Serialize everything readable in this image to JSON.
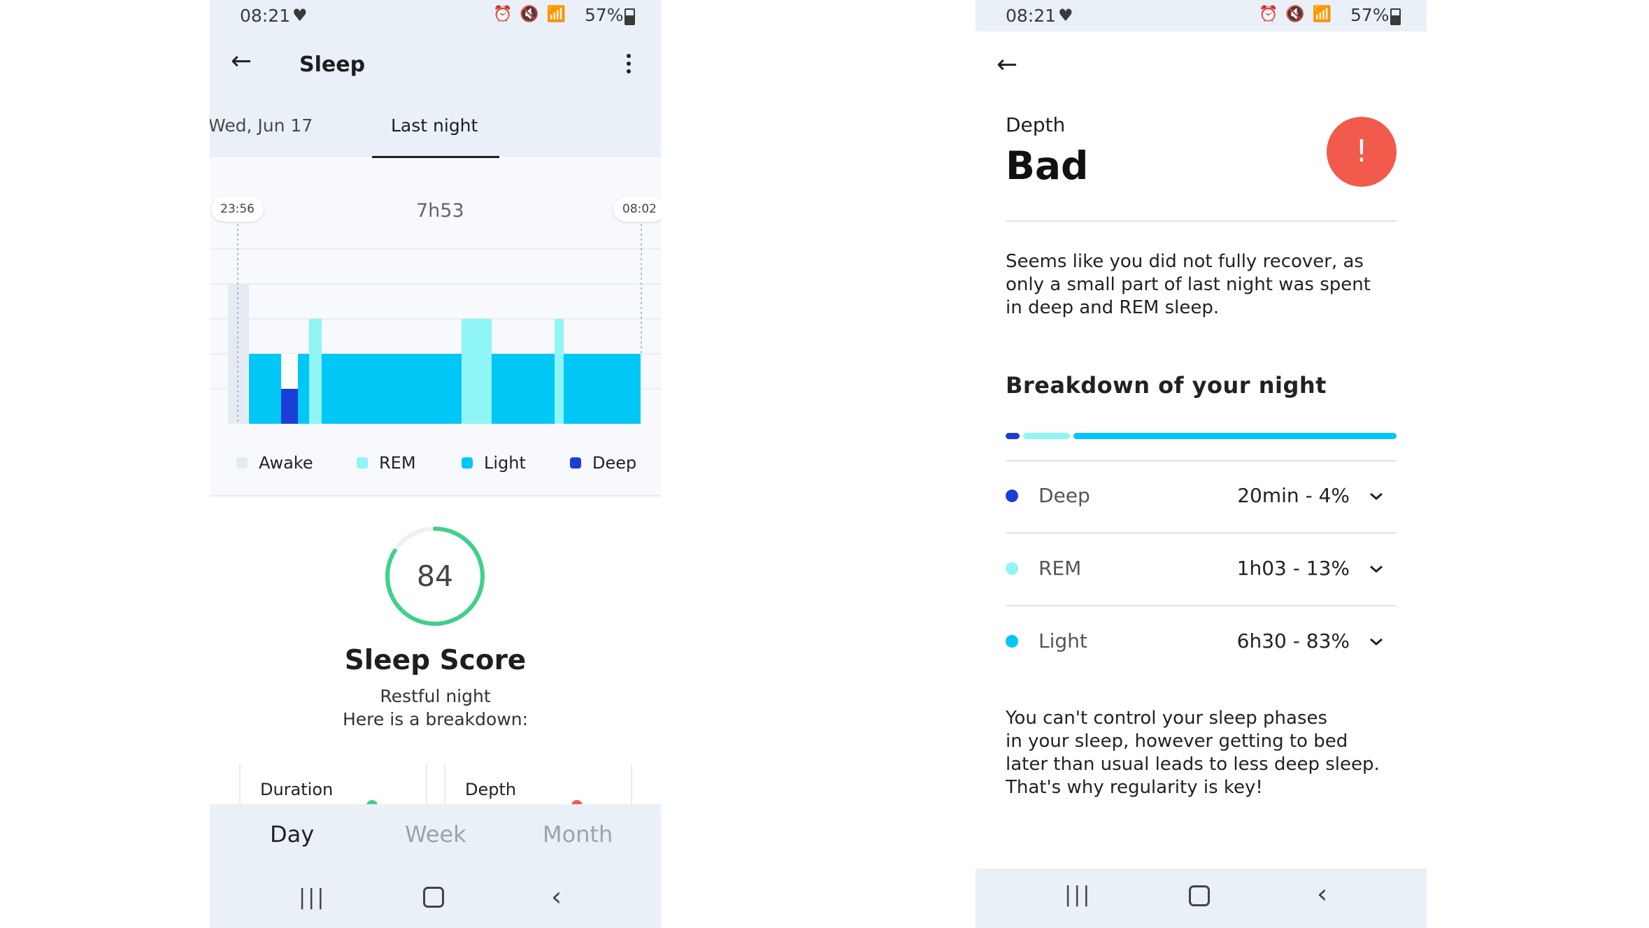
{
  "status_bar": {
    "time": "08:21",
    "battery": "57%"
  },
  "screen1": {
    "title": "Sleep",
    "tabs": [
      "Wed, Jun 17",
      "Last night"
    ],
    "chart": {
      "start_time": "23:56",
      "end_time": "08:02",
      "duration": "7h53",
      "legend": [
        {
          "label": "Awake",
          "color": "#e5ebf2"
        },
        {
          "label": "REM",
          "color": "#8ff5f5"
        },
        {
          "label": "Light",
          "color": "#00c7f5"
        },
        {
          "label": "Deep",
          "color": "#1b3fd6"
        }
      ]
    },
    "score": {
      "value": "84",
      "fraction": 0.84,
      "title": "Sleep Score",
      "subtitle_line1": "Restful night",
      "subtitle_line2": "Here is a breakdown:",
      "ring_color": "#3fd08c"
    },
    "cards": [
      {
        "label": "Duration",
        "dot_color": "#3fd08c"
      },
      {
        "label": "Depth",
        "dot_color": "#f25a4b"
      }
    ],
    "period_tabs": [
      "Day",
      "Week",
      "Month"
    ],
    "selected_period": "Day"
  },
  "screen2": {
    "label": "Depth",
    "value": "Bad",
    "alert_symbol": "!",
    "alert_color": "#f25a4b",
    "description_lines": [
      "Seems like you did not fully recover, as",
      "only a small part of last night was spent",
      "in deep and REM sleep."
    ],
    "breakdown_title": "Breakdown of your night",
    "breakdown": [
      {
        "name": "Deep",
        "value": "20min - 4%",
        "percent": 4,
        "color": "#1b3fd6"
      },
      {
        "name": "REM",
        "value": "1h03 - 13%",
        "percent": 13,
        "color": "#8ff5f5"
      },
      {
        "name": "Light",
        "value": "6h30 - 83%",
        "percent": 83,
        "color": "#00c7f5"
      }
    ],
    "advice_lines": [
      "You can't control your sleep phases",
      "in your sleep, however getting to bed",
      "later than usual leads to less deep sleep.",
      "That's why regularity is key!"
    ]
  }
}
